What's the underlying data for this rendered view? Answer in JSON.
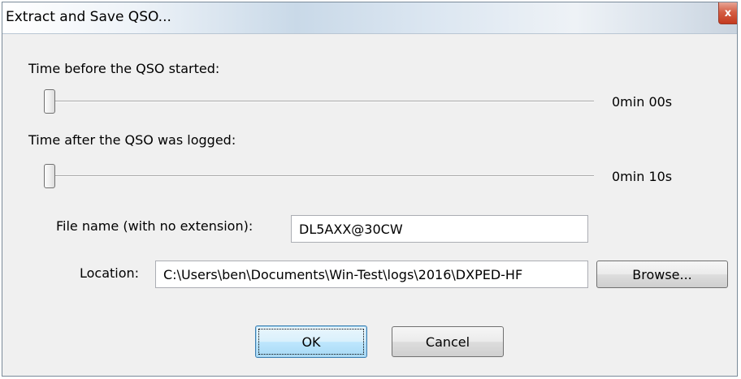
{
  "dialog": {
    "title": "Extract and Save QSO...",
    "close_symbol": "x"
  },
  "before": {
    "label": "Time before the QSO started:",
    "value_text": "0min 00s",
    "slider_fraction": 0.0
  },
  "after": {
    "label": "Time after the QSO was logged:",
    "value_text": "0min 10s",
    "slider_fraction": 0.0
  },
  "file": {
    "label": "File name (with no extension):",
    "value": "DL5AXX@30CW"
  },
  "location": {
    "label": "Location:",
    "value": "C:\\Users\\ben\\Documents\\Win-Test\\logs\\2016\\DXPED-HF",
    "browse_label": "Browse..."
  },
  "buttons": {
    "ok_label": "OK",
    "cancel_label": "Cancel"
  }
}
